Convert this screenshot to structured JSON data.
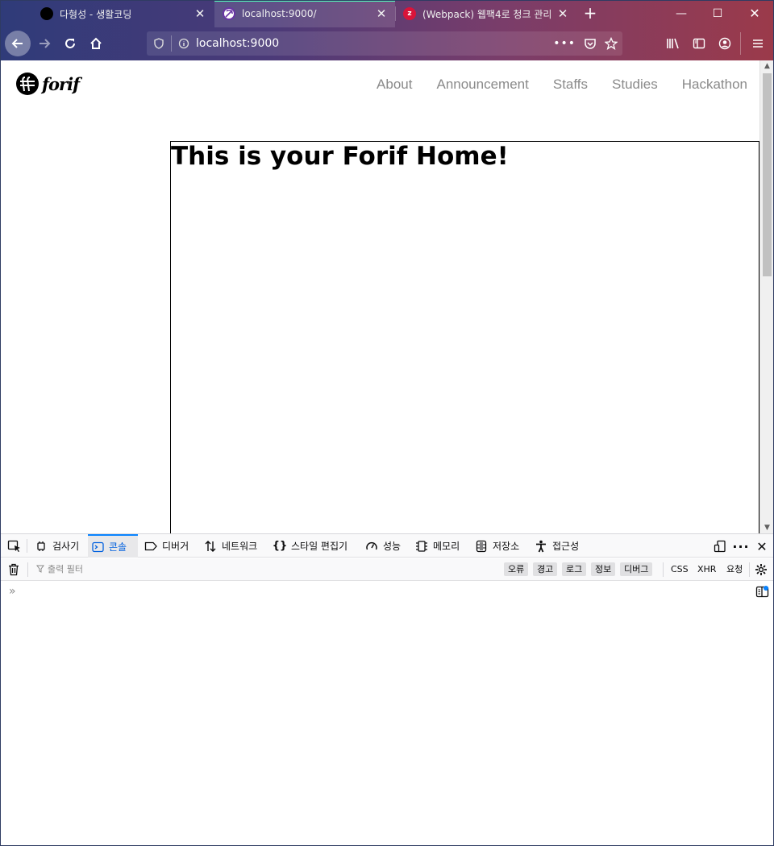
{
  "browser": {
    "tabs": [
      {
        "title": "다형성 - 생활코딩",
        "favicon": "black-circle-icon"
      },
      {
        "title": "localhost:9000/",
        "favicon": "gatsby-icon",
        "active": true
      },
      {
        "title": "(Webpack) 웹팩4로 청크 관리",
        "favicon": "zero-red-icon"
      }
    ],
    "url": "localhost:9000",
    "accent_color": "#54ffbd"
  },
  "site": {
    "logo_text": "forif",
    "nav": [
      "About",
      "Announcement",
      "Staffs",
      "Studies",
      "Hackathon"
    ],
    "heading": "This is your Forif Home!"
  },
  "devtools": {
    "tabs": [
      {
        "label": "검사기",
        "icon": "inspector-icon"
      },
      {
        "label": "콘솔",
        "icon": "console-icon",
        "selected": true
      },
      {
        "label": "디버거",
        "icon": "debugger-icon"
      },
      {
        "label": "네트워크",
        "icon": "network-icon"
      },
      {
        "label": "스타일 편집기",
        "icon": "style-editor-icon"
      },
      {
        "label": "성능",
        "icon": "performance-icon"
      },
      {
        "label": "메모리",
        "icon": "memory-icon"
      },
      {
        "label": "저장소",
        "icon": "storage-icon"
      },
      {
        "label": "접근성",
        "icon": "accessibility-icon"
      }
    ],
    "filter_placeholder": "출력 필터",
    "level_filters": [
      "오류",
      "경고",
      "로그",
      "정보",
      "디버그"
    ],
    "type_filters": [
      "CSS",
      "XHR",
      "요청"
    ],
    "prompt": "»"
  }
}
